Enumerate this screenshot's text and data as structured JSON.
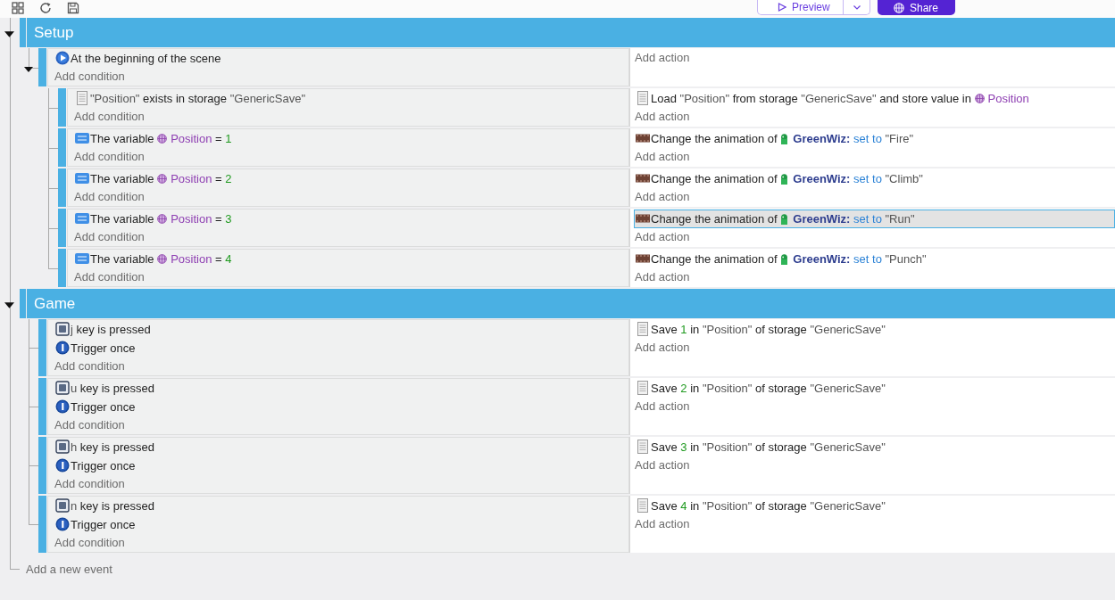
{
  "toolbar": {
    "preview_button": {
      "label": "Preview"
    },
    "share_button": {
      "label": "Share"
    }
  },
  "groups": [
    {
      "title": "Setup",
      "expanded": true,
      "events": [
        {
          "expanded": true,
          "conditions": [
            {
              "kind": "scene-start",
              "selected": false,
              "parts": [
                {
                  "kind": "text",
                  "text": "At the beginning of the scene"
                }
              ]
            }
          ],
          "add_condition": "Add condition",
          "add_action": "Add action",
          "children": [
            {
              "conditions": [
                {
                  "kind": "storage",
                  "selected": false,
                  "parts": [
                    {
                      "kind": "string",
                      "text": "\"Position\""
                    },
                    {
                      "kind": "text",
                      "text": "exists in storage"
                    },
                    {
                      "kind": "string",
                      "text": "\"GenericSave\""
                    }
                  ]
                }
              ],
              "add_condition": "Add condition",
              "actions": [
                {
                  "kind": "storage",
                  "selected": false,
                  "parts": [
                    {
                      "kind": "text",
                      "text": "Load"
                    },
                    {
                      "kind": "string",
                      "text": "\"Position\""
                    },
                    {
                      "kind": "text",
                      "text": "from storage"
                    },
                    {
                      "kind": "string",
                      "text": "\"GenericSave\""
                    },
                    {
                      "kind": "text",
                      "text": "and store value in"
                    },
                    {
                      "kind": "variable",
                      "text": "Position"
                    }
                  ]
                }
              ],
              "add_action": "Add action"
            },
            {
              "conditions": [
                {
                  "kind": "variable",
                  "selected": false,
                  "parts": [
                    {
                      "kind": "text",
                      "text": "The variable"
                    },
                    {
                      "kind": "variable",
                      "text": "Position"
                    },
                    {
                      "kind": "text",
                      "text": "="
                    },
                    {
                      "kind": "number",
                      "text": "1"
                    }
                  ]
                }
              ],
              "add_condition": "Add condition",
              "actions": [
                {
                  "kind": "animation",
                  "selected": false,
                  "parts": [
                    {
                      "kind": "text",
                      "text": "Change the animation of"
                    },
                    {
                      "kind": "object",
                      "text": "GreenWiz:"
                    },
                    {
                      "kind": "keyword",
                      "text": "set to"
                    },
                    {
                      "kind": "string",
                      "text": "\"Fire\""
                    }
                  ]
                }
              ],
              "add_action": "Add action"
            },
            {
              "conditions": [
                {
                  "kind": "variable",
                  "selected": false,
                  "parts": [
                    {
                      "kind": "text",
                      "text": "The variable"
                    },
                    {
                      "kind": "variable",
                      "text": "Position"
                    },
                    {
                      "kind": "text",
                      "text": "="
                    },
                    {
                      "kind": "number",
                      "text": "2"
                    }
                  ]
                }
              ],
              "add_condition": "Add condition",
              "actions": [
                {
                  "kind": "animation",
                  "selected": false,
                  "parts": [
                    {
                      "kind": "text",
                      "text": "Change the animation of"
                    },
                    {
                      "kind": "object",
                      "text": "GreenWiz:"
                    },
                    {
                      "kind": "keyword",
                      "text": "set to"
                    },
                    {
                      "kind": "string",
                      "text": "\"Climb\""
                    }
                  ]
                }
              ],
              "add_action": "Add action"
            },
            {
              "conditions": [
                {
                  "kind": "variable",
                  "selected": false,
                  "parts": [
                    {
                      "kind": "text",
                      "text": "The variable"
                    },
                    {
                      "kind": "variable",
                      "text": "Position"
                    },
                    {
                      "kind": "text",
                      "text": "="
                    },
                    {
                      "kind": "number",
                      "text": "3"
                    }
                  ]
                }
              ],
              "add_condition": "Add condition",
              "actions": [
                {
                  "kind": "animation",
                  "selected": true,
                  "parts": [
                    {
                      "kind": "text",
                      "text": "Change the animation of"
                    },
                    {
                      "kind": "object",
                      "text": "GreenWiz:"
                    },
                    {
                      "kind": "keyword",
                      "text": "set to"
                    },
                    {
                      "kind": "string",
                      "text": "\"Run\""
                    }
                  ]
                }
              ],
              "add_action": "Add action"
            },
            {
              "conditions": [
                {
                  "kind": "variable",
                  "selected": false,
                  "parts": [
                    {
                      "kind": "text",
                      "text": "The variable"
                    },
                    {
                      "kind": "variable",
                      "text": "Position"
                    },
                    {
                      "kind": "text",
                      "text": "="
                    },
                    {
                      "kind": "number",
                      "text": "4"
                    }
                  ]
                }
              ],
              "add_condition": "Add condition",
              "actions": [
                {
                  "kind": "animation",
                  "selected": false,
                  "parts": [
                    {
                      "kind": "text",
                      "text": "Change the animation of"
                    },
                    {
                      "kind": "object",
                      "text": "GreenWiz:"
                    },
                    {
                      "kind": "keyword",
                      "text": "set to"
                    },
                    {
                      "kind": "string",
                      "text": "\"Punch\""
                    }
                  ]
                }
              ],
              "add_action": "Add action"
            }
          ]
        }
      ]
    },
    {
      "title": "Game",
      "expanded": true,
      "events": [
        {
          "conditions": [
            {
              "kind": "key",
              "selected": false,
              "parts": [
                {
                  "kind": "string",
                  "text": "j"
                },
                {
                  "kind": "text",
                  "text": "key is pressed"
                }
              ]
            },
            {
              "kind": "trigger-once",
              "selected": false,
              "parts": [
                {
                  "kind": "text",
                  "text": "Trigger once"
                }
              ]
            }
          ],
          "add_condition": "Add condition",
          "actions": [
            {
              "kind": "storage",
              "selected": false,
              "parts": [
                {
                  "kind": "text",
                  "text": "Save"
                },
                {
                  "kind": "number",
                  "text": "1"
                },
                {
                  "kind": "text",
                  "text": "in"
                },
                {
                  "kind": "string",
                  "text": "\"Position\""
                },
                {
                  "kind": "text",
                  "text": "of storage"
                },
                {
                  "kind": "string",
                  "text": "\"GenericSave\""
                }
              ]
            }
          ],
          "add_action": "Add action"
        },
        {
          "conditions": [
            {
              "kind": "key",
              "selected": false,
              "parts": [
                {
                  "kind": "string",
                  "text": "u"
                },
                {
                  "kind": "text",
                  "text": "key is pressed"
                }
              ]
            },
            {
              "kind": "trigger-once",
              "selected": false,
              "parts": [
                {
                  "kind": "text",
                  "text": "Trigger once"
                }
              ]
            }
          ],
          "add_condition": "Add condition",
          "actions": [
            {
              "kind": "storage",
              "selected": false,
              "parts": [
                {
                  "kind": "text",
                  "text": "Save"
                },
                {
                  "kind": "number",
                  "text": "2"
                },
                {
                  "kind": "text",
                  "text": "in"
                },
                {
                  "kind": "string",
                  "text": "\"Position\""
                },
                {
                  "kind": "text",
                  "text": "of storage"
                },
                {
                  "kind": "string",
                  "text": "\"GenericSave\""
                }
              ]
            }
          ],
          "add_action": "Add action"
        },
        {
          "conditions": [
            {
              "kind": "key",
              "selected": false,
              "parts": [
                {
                  "kind": "string",
                  "text": "h"
                },
                {
                  "kind": "text",
                  "text": "key is pressed"
                }
              ]
            },
            {
              "kind": "trigger-once",
              "selected": false,
              "parts": [
                {
                  "kind": "text",
                  "text": "Trigger once"
                }
              ]
            }
          ],
          "add_condition": "Add condition",
          "actions": [
            {
              "kind": "storage",
              "selected": false,
              "parts": [
                {
                  "kind": "text",
                  "text": "Save"
                },
                {
                  "kind": "number",
                  "text": "3"
                },
                {
                  "kind": "text",
                  "text": "in"
                },
                {
                  "kind": "string",
                  "text": "\"Position\""
                },
                {
                  "kind": "text",
                  "text": "of storage"
                },
                {
                  "kind": "string",
                  "text": "\"GenericSave\""
                }
              ]
            }
          ],
          "add_action": "Add action"
        },
        {
          "conditions": [
            {
              "kind": "key",
              "selected": false,
              "parts": [
                {
                  "kind": "string",
                  "text": "n"
                },
                {
                  "kind": "text",
                  "text": "key is pressed"
                }
              ]
            },
            {
              "kind": "trigger-once",
              "selected": false,
              "parts": [
                {
                  "kind": "text",
                  "text": "Trigger once"
                }
              ]
            }
          ],
          "add_condition": "Add condition",
          "actions": [
            {
              "kind": "storage",
              "selected": false,
              "parts": [
                {
                  "kind": "text",
                  "text": "Save"
                },
                {
                  "kind": "number",
                  "text": "4"
                },
                {
                  "kind": "text",
                  "text": "in"
                },
                {
                  "kind": "string",
                  "text": "\"Position\""
                },
                {
                  "kind": "text",
                  "text": "of storage"
                },
                {
                  "kind": "string",
                  "text": "\"GenericSave\""
                }
              ]
            }
          ],
          "add_action": "Add action"
        }
      ]
    }
  ],
  "add_event": "Add a new event"
}
